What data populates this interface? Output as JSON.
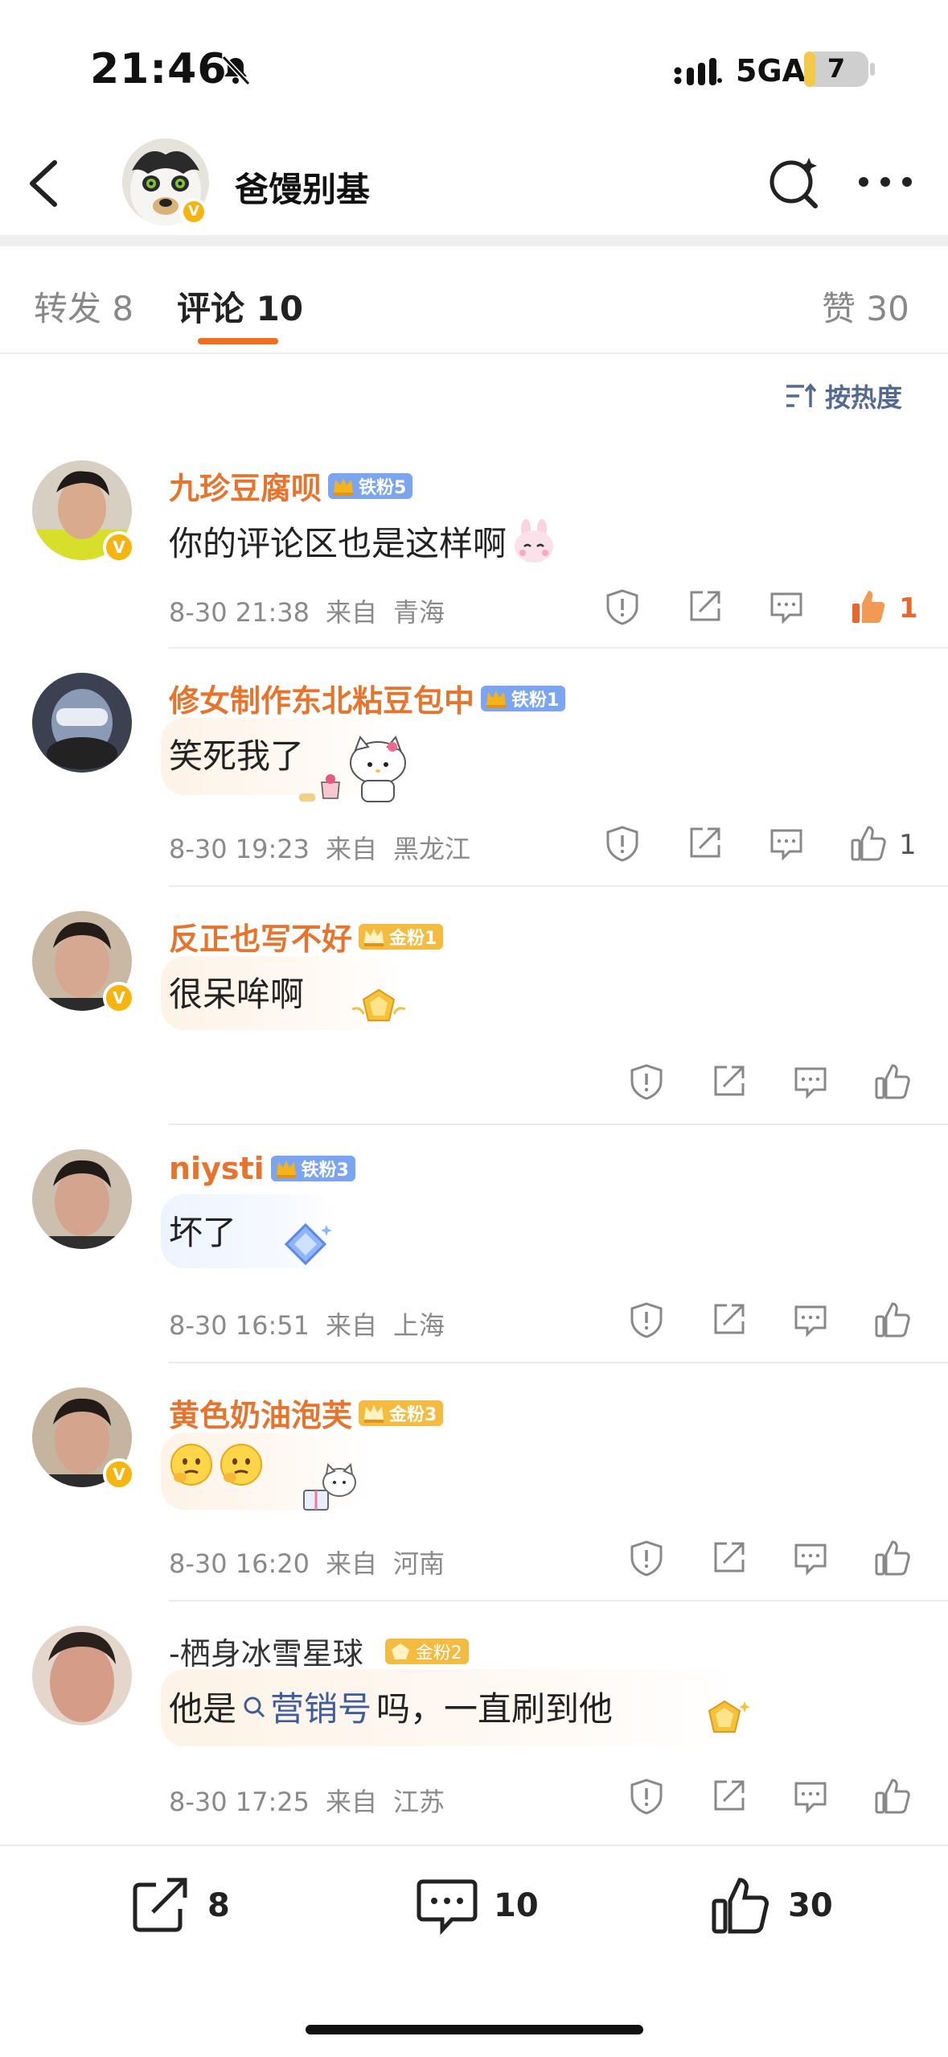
{
  "status_bar": {
    "time": "21:46",
    "network": "5GA",
    "battery": "7",
    "battery_level": 0.07
  },
  "nav": {
    "title": "爸馒别基",
    "verified": "V"
  },
  "tabs": [
    {
      "label": "转发 8"
    },
    {
      "label": "评论 10"
    },
    {
      "label": "赞 30"
    }
  ],
  "sort_label": "按热度",
  "comments": [
    {
      "name": "九珍豆腐呗",
      "fan_badge": "铁粉5",
      "text": "你的评论区也是这样啊",
      "time": "8-30 21:38",
      "location_prefix": "来自",
      "location": "青海",
      "likes": "1",
      "verified": "V"
    },
    {
      "name": "修女制作东北粘豆包中",
      "fan_badge": "铁粉1",
      "text": "笑死我了",
      "time": "8-30 19:23",
      "location_prefix": "来自",
      "location": "黑龙江",
      "likes": "1"
    },
    {
      "name": "反正也写不好",
      "fan_badge": "金粉1",
      "text": "很呆哞啊",
      "verified": "V"
    },
    {
      "name": "niysti",
      "fan_badge": "铁粉3",
      "text": "坏了",
      "time": "8-30 16:51",
      "location_prefix": "来自",
      "location": "上海"
    },
    {
      "name": "黄色奶油泡芙",
      "fan_badge": "金粉3",
      "text": "",
      "time": "8-30 16:20",
      "location_prefix": "来自",
      "location": "河南",
      "verified": "V"
    },
    {
      "name": "-栖身冰雪星球_",
      "fan_badge": "金粉2",
      "text_pre": "他是",
      "topic": "营销号",
      "text_post": "吗，一直刷到他",
      "time": "8-30 17:25",
      "location_prefix": "来自",
      "location": "江苏"
    }
  ],
  "bottom_bar": {
    "reposts": "8",
    "comments": "10",
    "likes": "30"
  },
  "colors": {
    "accent": "#f26c1e",
    "name": "#e7742c",
    "like_active": "#e8672f",
    "topic": "#3d5d9c",
    "verified": "#f5b40f"
  }
}
